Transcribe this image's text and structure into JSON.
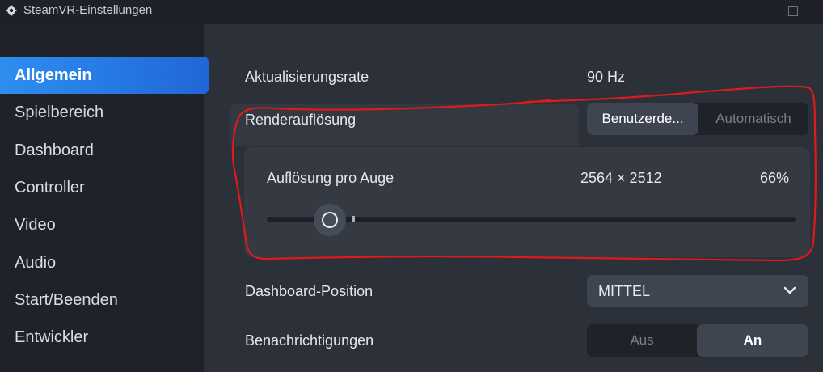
{
  "window": {
    "title": "SteamVR-Einstellungen",
    "icon": "steamvr-gear-icon"
  },
  "sidebar": {
    "items": [
      {
        "label": "Allgemein",
        "active": true
      },
      {
        "label": "Spielbereich",
        "active": false
      },
      {
        "label": "Dashboard",
        "active": false
      },
      {
        "label": "Controller",
        "active": false
      },
      {
        "label": "Video",
        "active": false
      },
      {
        "label": "Audio",
        "active": false
      },
      {
        "label": "Start/Beenden",
        "active": false
      },
      {
        "label": "Entwickler",
        "active": false
      }
    ]
  },
  "settings": {
    "refresh_rate": {
      "label": "Aktualisierungsrate",
      "value": "90 Hz"
    },
    "render_resolution": {
      "label": "Renderauflösung",
      "options": [
        "Benutzerde...",
        "Automatisch"
      ],
      "selected": "Benutzerde..."
    },
    "per_eye": {
      "label": "Auflösung pro Auge",
      "resolution": "2564 × 2512",
      "percent": "66%",
      "slider_fraction": 0.12
    },
    "dashboard_position": {
      "label": "Dashboard-Position",
      "value": "MITTEL"
    },
    "notifications": {
      "label": "Benachrichtigungen",
      "options": [
        "Aus",
        "An"
      ],
      "selected": "An"
    }
  },
  "colors": {
    "accent": "#2d8ff0",
    "annotation": "#e0191b"
  }
}
